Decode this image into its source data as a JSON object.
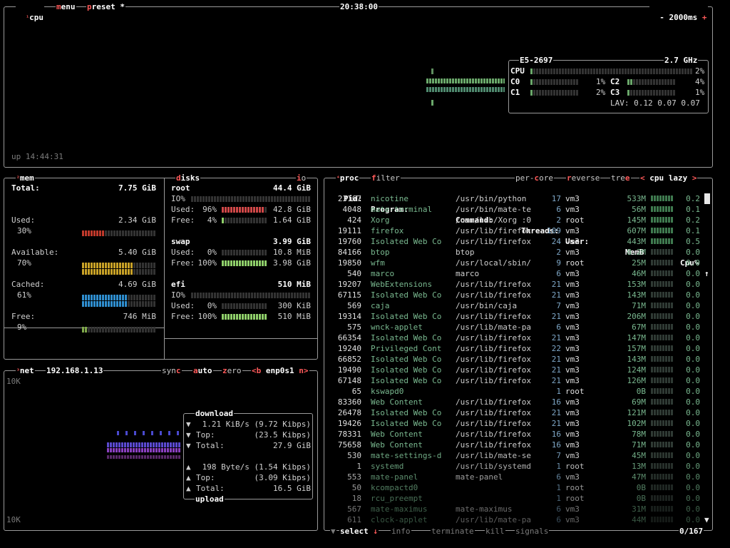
{
  "cpu_box": {
    "title_num": "¹",
    "title": "cpu",
    "menu": "menu",
    "preset": "preset *",
    "clock": "20:38:00",
    "minus": "-",
    "interval": "2000ms",
    "plus": "+",
    "uptime": "up 14:44:31",
    "model": "E5-2697",
    "freq": "2.7 GHz",
    "total_label": "CPU",
    "total_pct": "2%",
    "cores": [
      {
        "label": "C0",
        "pct": "1%",
        "level": 0.01
      },
      {
        "label": "C1",
        "pct": "2%",
        "level": 0.02
      },
      {
        "label": "C2",
        "pct": "4%",
        "level": 0.04
      },
      {
        "label": "C3",
        "pct": "1%",
        "level": 0.01
      }
    ],
    "load_avg": "LAV: 0.12 0.07 0.07"
  },
  "mem_box": {
    "title_num": "²",
    "title": "mem",
    "rows": [
      {
        "label": "Total:",
        "value": "7.75 GiB",
        "pct": ""
      },
      {
        "label": "Used:",
        "value": "2.34 GiB",
        "pct": "30%",
        "level": 0.3,
        "color": "#c0392b"
      },
      {
        "label": "Available:",
        "value": "5.40 GiB",
        "pct": "70%",
        "level": 0.7,
        "color": "#c9a227"
      },
      {
        "label": "Cached:",
        "value": "4.69 GiB",
        "pct": "61%",
        "level": 0.61,
        "color": "#2f8ecf"
      },
      {
        "label": "Free:",
        "value": "746 MiB",
        "pct": "9%",
        "level": 0.09,
        "color": "#7fa84a"
      }
    ]
  },
  "disks_box": {
    "title": "disks",
    "io_label": "io",
    "disks": [
      {
        "name": "root",
        "size": "44.4 GiB",
        "io": "IO%",
        "used_label": "Used:",
        "used_pct": "96%",
        "used_val": "42.8 GiB",
        "used_level": 0.96,
        "free_label": "Free:",
        "free_pct": "4%",
        "free_val": "1.64 GiB",
        "free_level": 0.04
      },
      {
        "name": "swap",
        "size": "3.99 GiB",
        "used_label": "Used:",
        "used_pct": "0%",
        "used_val": "10.8 MiB",
        "used_level": 0.0,
        "free_label": "Free:",
        "free_pct": "100%",
        "free_val": "3.98 GiB",
        "free_level": 1.0
      },
      {
        "name": "efi",
        "size": "510 MiB",
        "io": "IO%",
        "used_label": "Used:",
        "used_pct": "0%",
        "used_val": "300 KiB",
        "used_level": 0.0,
        "free_label": "Free:",
        "free_pct": "100%",
        "free_val": "510 MiB",
        "free_level": 1.0
      }
    ]
  },
  "net_box": {
    "title_num": "³",
    "title": "net",
    "ip": "192.168.1.13",
    "sync": "sync",
    "auto": "auto",
    "zero": "zero",
    "iface_prev": "<b",
    "iface": "enp0s1",
    "iface_next": "n>",
    "scale_top": "10K",
    "scale_bottom": "10K",
    "download_title": "download",
    "download": [
      {
        "arrow": "▼",
        "label": "",
        "value": "1.21 KiB/s (9.72 Kibps)"
      },
      {
        "arrow": "▼",
        "label": "Top:",
        "value": "(23.5 Kibps)"
      },
      {
        "arrow": "▼",
        "label": "Total:",
        "value": "27.9 GiB"
      }
    ],
    "upload": [
      {
        "arrow": "▲",
        "label": "",
        "value": "198 Byte/s (1.54 Kibps)"
      },
      {
        "arrow": "▲",
        "label": "Top:",
        "value": "(3.09 Kibps)"
      },
      {
        "arrow": "▲",
        "label": "Total:",
        "value": "16.5 GiB"
      }
    ],
    "upload_title": "upload"
  },
  "proc_box": {
    "title_num": "⁴",
    "title": "proc",
    "filter": "filter",
    "per_core": "per-core",
    "reverse": "reverse",
    "tree": "tree",
    "sort_prev": "<",
    "sort": "cpu lazy",
    "sort_next": ">",
    "headers": {
      "pid": "Pid:",
      "program": "Program:",
      "command": "Command:",
      "threads": "Threads:",
      "user": "User:",
      "memb": "MemB",
      "cpu": "Cpu%",
      "arrow": "↑"
    },
    "rows": [
      {
        "pid": "23167",
        "program": "nicotine",
        "command": "/usr/bin/python",
        "threads": "17",
        "user": "vm3",
        "mem": "533M",
        "cpu": "0.2"
      },
      {
        "pid": "4048",
        "program": "mate-terminal",
        "command": "/usr/bin/mate-te",
        "threads": "6",
        "user": "vm3",
        "mem": "56M",
        "cpu": "0.1"
      },
      {
        "pid": "424",
        "program": "Xorg",
        "command": "/usr/lib/Xorg :0",
        "threads": "2",
        "user": "root",
        "mem": "145M",
        "cpu": "0.2"
      },
      {
        "pid": "19111",
        "program": "firefox",
        "command": "/usr/lib/firefox",
        "threads": "109",
        "user": "vm3",
        "mem": "607M",
        "cpu": "0.1"
      },
      {
        "pid": "19760",
        "program": "Isolated Web Co",
        "command": "/usr/lib/firefox",
        "threads": "24",
        "user": "vm3",
        "mem": "443M",
        "cpu": "0.5"
      },
      {
        "pid": "84166",
        "program": "btop",
        "command": "btop",
        "threads": "2",
        "user": "vm3",
        "mem": "8.2M",
        "cpu": "0.0"
      },
      {
        "pid": "19850",
        "program": "wfm",
        "command": "/usr/local/sbin/",
        "threads": "9",
        "user": "root",
        "mem": "25M",
        "cpu": "0.0"
      },
      {
        "pid": "540",
        "program": "marco",
        "command": "marco",
        "threads": "6",
        "user": "vm3",
        "mem": "46M",
        "cpu": "0.0"
      },
      {
        "pid": "19207",
        "program": "WebExtensions",
        "command": "/usr/lib/firefox",
        "threads": "21",
        "user": "vm3",
        "mem": "153M",
        "cpu": "0.0"
      },
      {
        "pid": "67115",
        "program": "Isolated Web Co",
        "command": "/usr/lib/firefox",
        "threads": "21",
        "user": "vm3",
        "mem": "143M",
        "cpu": "0.0"
      },
      {
        "pid": "569",
        "program": "caja",
        "command": "/usr/bin/caja",
        "threads": "7",
        "user": "vm3",
        "mem": "71M",
        "cpu": "0.0"
      },
      {
        "pid": "19314",
        "program": "Isolated Web Co",
        "command": "/usr/lib/firefox",
        "threads": "21",
        "user": "vm3",
        "mem": "206M",
        "cpu": "0.0"
      },
      {
        "pid": "575",
        "program": "wnck-applet",
        "command": "/usr/lib/mate-pa",
        "threads": "6",
        "user": "vm3",
        "mem": "67M",
        "cpu": "0.0"
      },
      {
        "pid": "66354",
        "program": "Isolated Web Co",
        "command": "/usr/lib/firefox",
        "threads": "21",
        "user": "vm3",
        "mem": "147M",
        "cpu": "0.0"
      },
      {
        "pid": "19240",
        "program": "Privileged Cont",
        "command": "/usr/lib/firefox",
        "threads": "22",
        "user": "vm3",
        "mem": "157M",
        "cpu": "0.0"
      },
      {
        "pid": "66852",
        "program": "Isolated Web Co",
        "command": "/usr/lib/firefox",
        "threads": "21",
        "user": "vm3",
        "mem": "143M",
        "cpu": "0.0"
      },
      {
        "pid": "19490",
        "program": "Isolated Web Co",
        "command": "/usr/lib/firefox",
        "threads": "21",
        "user": "vm3",
        "mem": "124M",
        "cpu": "0.0"
      },
      {
        "pid": "67148",
        "program": "Isolated Web Co",
        "command": "/usr/lib/firefox",
        "threads": "21",
        "user": "vm3",
        "mem": "126M",
        "cpu": "0.0"
      },
      {
        "pid": "65",
        "program": "kswapd0",
        "command": "",
        "threads": "1",
        "user": "root",
        "mem": "0B",
        "cpu": "0.0"
      },
      {
        "pid": "83360",
        "program": "Web Content",
        "command": "/usr/lib/firefox",
        "threads": "16",
        "user": "vm3",
        "mem": "69M",
        "cpu": "0.0"
      },
      {
        "pid": "26478",
        "program": "Isolated Web Co",
        "command": "/usr/lib/firefox",
        "threads": "21",
        "user": "vm3",
        "mem": "121M",
        "cpu": "0.0"
      },
      {
        "pid": "19426",
        "program": "Isolated Web Co",
        "command": "/usr/lib/firefox",
        "threads": "21",
        "user": "vm3",
        "mem": "102M",
        "cpu": "0.0"
      },
      {
        "pid": "78331",
        "program": "Web Content",
        "command": "/usr/lib/firefox",
        "threads": "16",
        "user": "vm3",
        "mem": "78M",
        "cpu": "0.0"
      },
      {
        "pid": "75658",
        "program": "Web Content",
        "command": "/usr/lib/firefox",
        "threads": "16",
        "user": "vm3",
        "mem": "71M",
        "cpu": "0.0"
      },
      {
        "pid": "530",
        "program": "mate-settings-d",
        "command": "/usr/lib/mate-se",
        "threads": "7",
        "user": "vm3",
        "mem": "45M",
        "cpu": "0.0"
      },
      {
        "pid": "1",
        "program": "systemd",
        "command": "/usr/lib/systemd",
        "threads": "1",
        "user": "root",
        "mem": "13M",
        "cpu": "0.0"
      },
      {
        "pid": "553",
        "program": "mate-panel",
        "command": "mate-panel",
        "threads": "6",
        "user": "vm3",
        "mem": "47M",
        "cpu": "0.0"
      },
      {
        "pid": "50",
        "program": "kcompactd0",
        "command": "",
        "threads": "1",
        "user": "root",
        "mem": "0B",
        "cpu": "0.0"
      },
      {
        "pid": "18",
        "program": "rcu_preempt",
        "command": "",
        "threads": "1",
        "user": "root",
        "mem": "0B",
        "cpu": "0.0"
      },
      {
        "pid": "567",
        "program": "mate-maximus",
        "command": "mate-maximus",
        "threads": "6",
        "user": "vm3",
        "mem": "31M",
        "cpu": "0.0"
      },
      {
        "pid": "611",
        "program": "clock-applet",
        "command": "/usr/lib/mate-pa",
        "threads": "6",
        "user": "vm3",
        "mem": "44M",
        "cpu": "0.0"
      }
    ],
    "footer": {
      "select": "select",
      "select_arrow": "↓",
      "info": "info",
      "terminate": "terminate",
      "kill": "kill",
      "signals": "signals",
      "count": "0/167",
      "down_arrow": "▼"
    }
  }
}
